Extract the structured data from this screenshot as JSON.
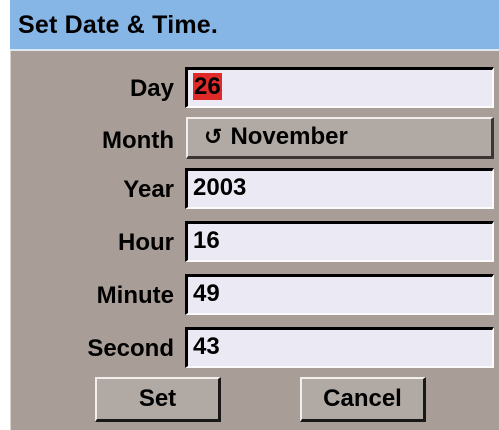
{
  "window": {
    "title": "Set Date & Time."
  },
  "fields": {
    "day": {
      "label": "Day",
      "value": "26"
    },
    "month": {
      "label": "Month",
      "value": "November",
      "icon": "cycle-icon"
    },
    "year": {
      "label": "Year",
      "value": "2003"
    },
    "hour": {
      "label": "Hour",
      "value": "16"
    },
    "minute": {
      "label": "Minute",
      "value": "49"
    },
    "second": {
      "label": "Second",
      "value": "43"
    }
  },
  "buttons": {
    "set_label": "Set",
    "cancel_label": "Cancel"
  },
  "colors": {
    "titlebar": "#86b6e6",
    "window_bg": "#a89e97",
    "field_bg": "#ebe9f4",
    "selection_highlight": "#e02a2a"
  }
}
